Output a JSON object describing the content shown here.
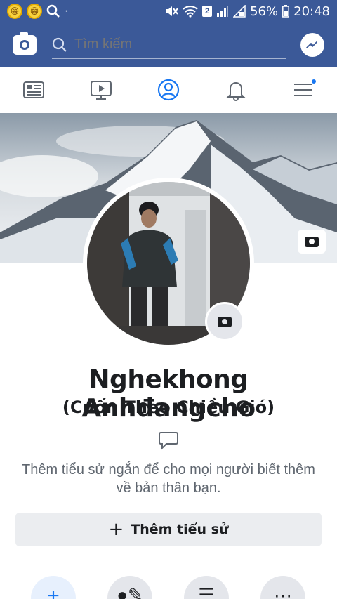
{
  "status_bar": {
    "battery": "56%",
    "time": "20:48",
    "sim_badge": "2"
  },
  "header": {
    "search_placeholder": "Tìm kiếm",
    "icons": [
      "camera-icon",
      "search-icon",
      "messenger-icon"
    ]
  },
  "tabs": [
    {
      "name": "news-feed",
      "icon": "news-feed-icon"
    },
    {
      "name": "watch",
      "icon": "video-icon"
    },
    {
      "name": "profile",
      "icon": "profile-icon",
      "active": true
    },
    {
      "name": "notifications",
      "icon": "bell-icon"
    },
    {
      "name": "menu",
      "icon": "menu-icon",
      "badge": true
    }
  ],
  "profile": {
    "name": "Nghekhong Anhđangcho",
    "alternate_name": "(Cuốn Theo Chiều Gió)",
    "bio_hint": "Thêm tiểu sử ngắn để cho mọi người biết thêm về bản thân bạn.",
    "add_bio_label": "Thêm tiểu sử"
  },
  "actions": [
    {
      "icon": "plus-icon",
      "glyph": "+"
    },
    {
      "icon": "edit-profile-icon",
      "glyph": "●✎"
    },
    {
      "icon": "list-icon",
      "glyph": "☰"
    },
    {
      "icon": "more-icon",
      "glyph": "···"
    }
  ],
  "colors": {
    "brand": "#3b5998",
    "accent": "#1877f2",
    "text": "#1c1e21",
    "muted": "#606770"
  }
}
